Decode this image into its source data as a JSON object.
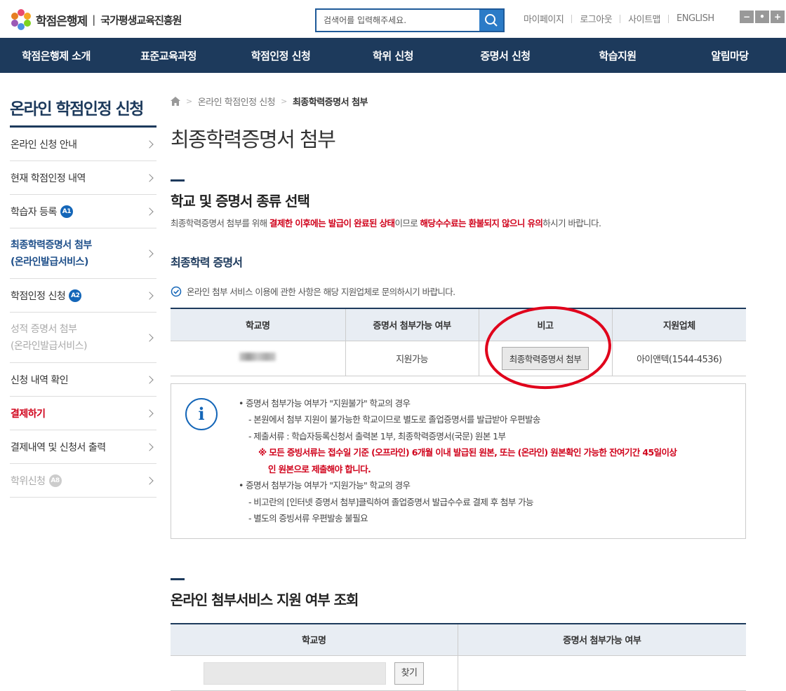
{
  "header": {
    "logo_title": "학점은행제",
    "logo_org": "국가평생교육진흥원",
    "search_placeholder": "검색어를 입력해주세요.",
    "util_links": [
      "마이페이지",
      "로그아웃",
      "사이트맵",
      "ENGLISH"
    ],
    "zoom": [
      "−",
      "•",
      "+"
    ]
  },
  "gnb": [
    "학점은행제 소개",
    "표준교육과정",
    "학점인정 신청",
    "학위 신청",
    "증명서 신청",
    "학습지원",
    "알림마당"
  ],
  "sidebar": {
    "title": "온라인 학점인정 신청",
    "items": [
      {
        "line1": "온라인 신청 안내",
        "line2": "",
        "badge": "",
        "state": "normal"
      },
      {
        "line1": "현재 학점인정 내역",
        "line2": "",
        "badge": "",
        "state": "normal"
      },
      {
        "line1": "학습자 등록",
        "line2": "",
        "badge": "A1",
        "state": "normal"
      },
      {
        "line1": "최종학력증명서 첨부",
        "line2": "(온라인발급서비스)",
        "badge": "",
        "state": "active"
      },
      {
        "line1": "학점인정 신청",
        "line2": "",
        "badge": "A2",
        "state": "normal"
      },
      {
        "line1": "성적 증명서 첨부",
        "line2": "(온라인발급서비스)",
        "badge": "",
        "state": "gray"
      },
      {
        "line1": "신청 내역 확인",
        "line2": "",
        "badge": "",
        "state": "normal"
      },
      {
        "line1": "결제하기",
        "line2": "",
        "badge": "",
        "state": "red"
      },
      {
        "line1": "결제내역 및 신청서 출력",
        "line2": "",
        "badge": "",
        "state": "normal"
      },
      {
        "line1": "학위신청",
        "line2": "",
        "badge": "A8",
        "state": "gray"
      }
    ]
  },
  "breadcrumb": {
    "parent": "온라인 학점인정 신청",
    "current": "최종학력증명서 첨부"
  },
  "page_title": "최종학력증명서 첨부",
  "section1": {
    "title": "학교 및 증명서 종류 선택",
    "desc_a": "최종학력증명서 첨부를 위해 ",
    "desc_warn1": "결제한 이후에는 발급이 완료된 상태",
    "desc_b": "이므로 ",
    "desc_warn2": "해당수수료는 환불되지 않으니 유의",
    "desc_c": "하시기 바랍니다.",
    "sub_title": "최종학력 증명서",
    "note": "온라인 첨부 서비스 이용에 관한 사항은 해당 지원업체로 문의하시기 바랍니다.",
    "table": {
      "headers": [
        "학교명",
        "증명서 첨부가능 여부",
        "비고",
        "지원업체"
      ],
      "row": {
        "availability": "지원가능",
        "button": "최종학력증명서 첨부",
        "vendor": "아이앤텍(1544-4536)"
      }
    },
    "info": {
      "icon": "i",
      "lines": [
        "• 증명서 첨부가능 여부가 \"지원불가\" 학교의 경우",
        "- 본원에서 첨부 지원이 불가능한 학교이므로 별도로 졸업증명서를 발급받아 우편발송",
        "- 제출서류 : 학습자등록신청서 출력본 1부, 최종학력증명서(국문) 원본 1부",
        "※ 모든 증빙서류는 접수일 기준 (오프라인) 6개월 이내 발급된 원본, 또는 (온라인) 원본확인 가능한 잔여기간 45일이상",
        "인 원본으로 제출해야 합니다.",
        "• 증명서 첨부가능 여부가 \"지원가능\" 학교의 경우",
        "- 비고란의 [인터넷 증명서 첨부]클릭하여 졸업증명서 발급수수료 결제 후 첨부 가능",
        "- 별도의 증빙서류 우편발송 불필요"
      ]
    }
  },
  "section2": {
    "title": "온라인 첨부서비스 지원 여부 조회",
    "headers": [
      "학교명",
      "증명서 첨부가능 여부"
    ],
    "find_button": "찾기"
  },
  "colors": {
    "navy": "#1d3a5c",
    "blue": "#1466b8",
    "red": "#d0021b",
    "annotation": "#e0001b"
  }
}
